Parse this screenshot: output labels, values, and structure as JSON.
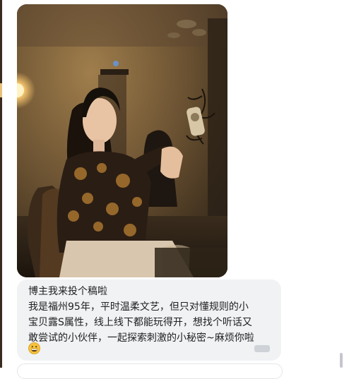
{
  "message": {
    "lines": [
      "博主我来投个稿啦",
      "我是福州95年，平时温柔文艺，但只对懂规则的小",
      "宝贝露S属性，线上线下都能玩得开，想找个听话又",
      "敢尝试的小伙伴，一起探索刺激的小秘密~麻烦你啦"
    ],
    "emoji": "grinning-face"
  },
  "colors": {
    "bubble_background": "#f0f2f4",
    "text": "#1f1f1f"
  }
}
